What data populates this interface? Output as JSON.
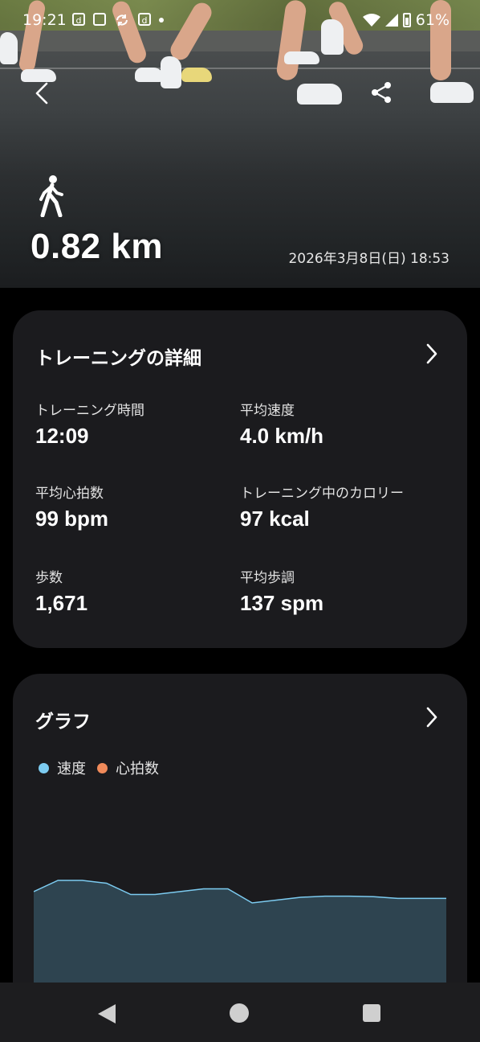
{
  "status_bar": {
    "time": "19:21",
    "icons": [
      "d-icon",
      "sim-icon",
      "sync-icon",
      "d-icon",
      "dot-icon"
    ],
    "battery": "61%"
  },
  "hero": {
    "activity_icon": "walking-icon",
    "distance": "0.82 km",
    "datetime": "2026年3月8日(日) 18:53"
  },
  "details": {
    "title": "トレーニングの詳細",
    "stats": [
      {
        "label": "トレーニング時間",
        "value": "12:09"
      },
      {
        "label": "平均速度",
        "value": "4.0 km/h"
      },
      {
        "label": "平均心拍数",
        "value": "99 bpm"
      },
      {
        "label": "トレーニング中のカロリー",
        "value": "97 kcal"
      },
      {
        "label": "歩数",
        "value": "1,671"
      },
      {
        "label": "平均歩調",
        "value": "137 spm"
      }
    ]
  },
  "graph": {
    "title": "グラフ",
    "legend": [
      {
        "label": "速度",
        "color": "#7ccbf0"
      },
      {
        "label": "心拍数",
        "color": "#f08a5a"
      }
    ]
  },
  "chart_data": {
    "type": "area",
    "series": [
      {
        "name": "速度",
        "values": [
          4.1,
          4.3,
          4.3,
          4.25,
          4.05,
          4.05,
          4.1,
          4.15,
          4.15,
          3.9,
          3.95,
          4.0,
          4.02,
          4.02,
          4.01,
          3.98,
          3.98,
          3.98
        ]
      }
    ],
    "ylim": [
      0,
      5
    ]
  },
  "colors": {
    "card_bg": "#1b1b1e",
    "area_fill": "#2e4450",
    "area_line": "#7ccbf0"
  }
}
